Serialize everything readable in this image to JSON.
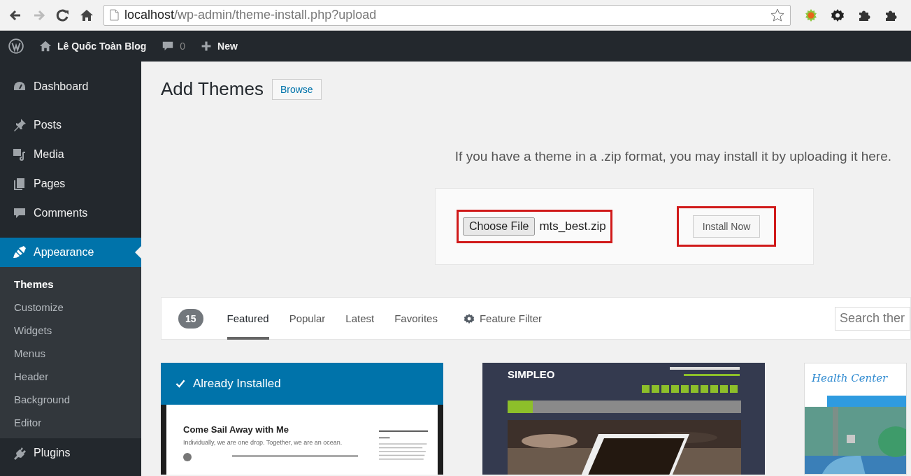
{
  "browser": {
    "url_host": "localhost",
    "url_path": "/wp-admin/theme-install.php?upload",
    "bookmarked": false
  },
  "admin_bar": {
    "site": "Lê Quốc Toàn Blog",
    "comments": "0",
    "new": "New"
  },
  "sidebar": {
    "items": [
      {
        "label": "Dashboard",
        "selected": false
      },
      {
        "label": "Posts",
        "selected": false
      },
      {
        "label": "Media",
        "selected": false
      },
      {
        "label": "Pages",
        "selected": false
      },
      {
        "label": "Comments",
        "selected": false
      },
      {
        "label": "Appearance",
        "selected": true,
        "children": [
          {
            "label": "Themes",
            "selected": true
          },
          {
            "label": "Customize",
            "selected": false
          },
          {
            "label": "Widgets",
            "selected": false
          },
          {
            "label": "Menus",
            "selected": false
          },
          {
            "label": "Header",
            "selected": false
          },
          {
            "label": "Background",
            "selected": false
          },
          {
            "label": "Editor",
            "selected": false
          }
        ]
      },
      {
        "label": "Plugins",
        "selected": false
      }
    ]
  },
  "page": {
    "title": "Add Themes",
    "browse_button": "Browse",
    "upload_text": "If you have a theme in a .zip format, you may install it by uploading it here.",
    "file_control": {
      "button": "Choose File",
      "value": "mts_best.zip",
      "highlighted": true
    },
    "install_button": {
      "label": "Install Now",
      "highlighted": true
    }
  },
  "filter_bar": {
    "count": "15",
    "tabs": [
      {
        "label": "Featured",
        "selected": true
      },
      {
        "label": "Popular",
        "selected": false
      },
      {
        "label": "Latest",
        "selected": false
      },
      {
        "label": "Favorites",
        "selected": false
      }
    ],
    "feature_filter": "Feature Filter",
    "search_placeholder": "Search ther"
  },
  "themes": [
    {
      "kind": "installed",
      "banner": "Already Installed",
      "title": "Come Sail Away with Me",
      "tagline": "Individually, we are one drop. Together, we are an ocean."
    },
    {
      "kind": "simpleo",
      "name": "SIMPLEO"
    },
    {
      "kind": "health",
      "name": "Health Center"
    }
  ]
}
